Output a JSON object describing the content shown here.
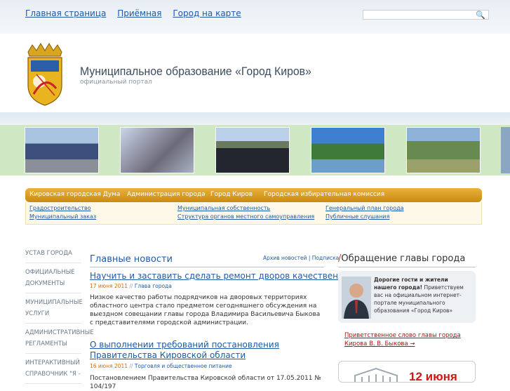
{
  "topnav": {
    "home": "Главная страница",
    "reception": "Приёмная",
    "map": "Город на карте"
  },
  "search": {
    "placeholder": "",
    "icon": "search-icon"
  },
  "header": {
    "title": "Муниципальное образование «Город Киров»",
    "subtitle": "официальный портал"
  },
  "menu": {
    "items": [
      "Кировская городская Дума",
      "Администрация города",
      "Город Киров",
      "Городская избирательная комиссия"
    ]
  },
  "submenu": {
    "items": [
      "Градостроительство",
      "Муниципальный заказ",
      "Муниципальная собственность",
      "Структура органов местного самоуправления",
      "Генеральный план города",
      "Публичные слушания"
    ]
  },
  "sidebar": {
    "items": [
      "УСТАВ ГОРОДА",
      "ОФИЦИАЛЬНЫЕ ДОКУМЕНТЫ",
      "МУНИЦИПАЛЬНЫЕ УСЛУГИ",
      "АДМИНИСТРАТИВНЫЕ РЕГЛАМЕНТЫ",
      "ИНТЕРАКТИВНЫЙ СПРАВОЧНИК \"Я -"
    ]
  },
  "news": {
    "title": "Главные новости",
    "archive": "Архив новостей",
    "subscribe": "Подписка",
    "items": [
      {
        "headline": "Научить и заставить сделать ремонт дворов качественно",
        "date": "17 июня 2011",
        "category": "Глава города",
        "text": "Низкое качество работы подрядчиков на дворовых территориях областного центра стало предметом сегодняшнего обсуждения на выездном совещании главы города Владимира Васильевича Быкова с представителями городской администрации."
      },
      {
        "headline": "О выполнении требований постановления Правительства Кировской области",
        "date": "16 июня 2011",
        "category": "Торговля и общественное питание",
        "text": "Постановлением Правительства Кировской области от 17.05.2011 № 104/197"
      }
    ]
  },
  "appeal": {
    "slash": "/",
    "title": "Обращение главы города",
    "bold": "Дорогие гости и жители нашего города!",
    "text": " Приветствуем вас на официальном интернет-портале муниципального образования «Город Киров»",
    "link": "Приветственное слово главы города Кирова В. В. Быкова →"
  },
  "banner": {
    "date": "12 июня"
  }
}
